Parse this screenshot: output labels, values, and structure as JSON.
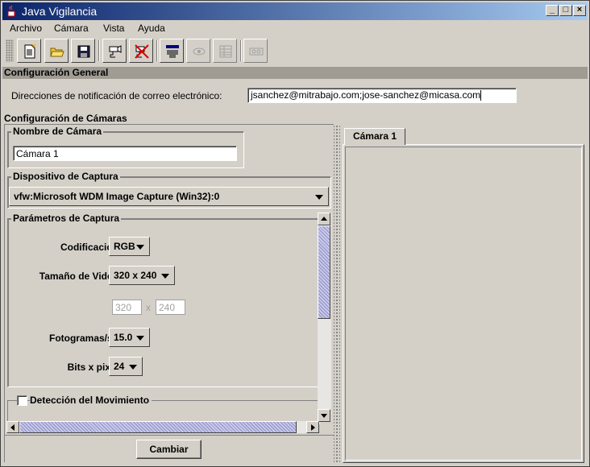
{
  "window": {
    "title": "Java Vigilancia",
    "buttons": {
      "minimize": "_",
      "maximize": "□",
      "close": "×"
    }
  },
  "menu": [
    {
      "label": "Archivo"
    },
    {
      "label": "Cámara"
    },
    {
      "label": "Vista"
    },
    {
      "label": "Ayuda"
    }
  ],
  "toolbar": {
    "icons": [
      "new-document-icon",
      "open-folder-icon",
      "save-disk-icon",
      "camera-connect-icon",
      "camera-remove-icon",
      "properties-icon",
      "eye-view-icon",
      "grid-table-icon",
      "record-tape-icon"
    ]
  },
  "general": {
    "heading": "Configuración General",
    "email_label": "Direcciones de notificación de correo electrónico:",
    "email_value": "jsanchez@mitrabajo.com;jose-sanchez@micasa.com"
  },
  "cameras": {
    "heading": "Configuración de Cámaras",
    "name_group": "Nombre de Cámara",
    "name_value": "Cámara 1",
    "device_group": "Dispositivo de Captura",
    "device_value": "vfw:Microsoft WDM Image Capture (Win32):0",
    "params_group": "Parámetros de Captura",
    "codec_label": "Codificación:",
    "codec_value": "RGB",
    "size_label": "Tamaño de Video:",
    "size_value": "320 x 240",
    "width_value": "320",
    "times": "x",
    "height_value": "240",
    "fps_label": "Fotogramas/sg:",
    "fps_value": "15.0",
    "bpp_label": "Bits x pixel:",
    "bpp_value": "24",
    "motion_label": "Detección del Movimiento",
    "apply_button": "Cambiar"
  },
  "tabs": [
    {
      "label": "Cámara 1"
    }
  ]
}
